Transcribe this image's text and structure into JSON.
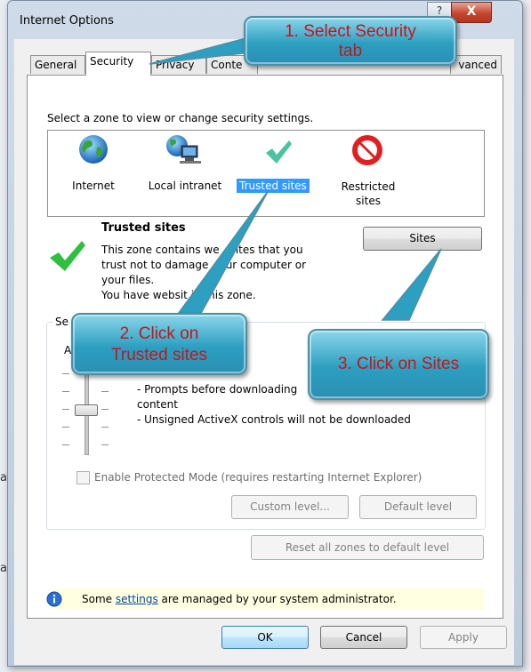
{
  "window": {
    "title": "Internet Options",
    "help": "?",
    "close": "X"
  },
  "tabs": [
    "General",
    "Security",
    "Privacy",
    "Conte",
    "Advanced"
  ],
  "tabs_visible": [
    "General",
    "Security",
    "Privacy",
    "Conte",
    "vanced"
  ],
  "security": {
    "zone_prompt": "Select a zone to view or change security settings.",
    "zones": [
      {
        "label": "Internet",
        "icon": "globe-icon"
      },
      {
        "label": "Local intranet",
        "icon": "intranet-icon"
      },
      {
        "label": "Trusted sites",
        "icon": "checkmark-icon",
        "selected": true
      },
      {
        "label": "Restricted\nsites",
        "icon": "restricted-icon"
      }
    ],
    "zone_title": "Trusted sites",
    "zone_desc_1": "This zone contains we",
    "zone_desc_1b": "sites that you",
    "zone_desc_2": "trust not to damage",
    "zone_desc_2b": "our computer or",
    "zone_desc_3": "your files.",
    "zone_desc_4": "You have websit",
    "zone_desc_4b": " in this zone.",
    "sites_button": "Sites",
    "group_label_partial": "Se",
    "group_label_partial2": "A",
    "level_line_1": "- Prompts before downloading",
    "level_line_2": "content",
    "level_line_3": "- Unsigned ActiveX controls will not be downloaded",
    "protected_mode": "Enable Protected Mode (requires restarting Internet Explorer)",
    "custom_level": "Custom level...",
    "default_level": "Default level",
    "reset_all": "Reset all zones to default level",
    "info_before": "Some ",
    "info_link": "settings",
    "info_after": " are managed by your system administrator."
  },
  "footer": {
    "ok": "OK",
    "cancel": "Cancel",
    "apply": "Apply"
  },
  "callouts": {
    "c1": "1. Select Security\ntab",
    "c2": "2. Click on\nTrusted sites",
    "c3": "3. Click on Sites"
  },
  "background": {
    "frag1": "a",
    "frag2": "a"
  },
  "colors": {
    "callout_text": "#c6151b",
    "callout_fill": "#2d9fc0",
    "selection": "#3399ff"
  }
}
